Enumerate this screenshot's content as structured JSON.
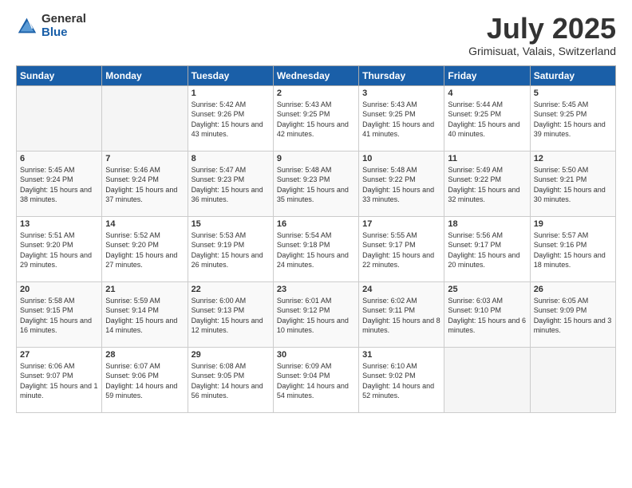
{
  "logo": {
    "general": "General",
    "blue": "Blue"
  },
  "header": {
    "month": "July 2025",
    "location": "Grimisuat, Valais, Switzerland"
  },
  "weekdays": [
    "Sunday",
    "Monday",
    "Tuesday",
    "Wednesday",
    "Thursday",
    "Friday",
    "Saturday"
  ],
  "weeks": [
    [
      {
        "day": "",
        "empty": true
      },
      {
        "day": "",
        "empty": true
      },
      {
        "day": "1",
        "sunrise": "5:42 AM",
        "sunset": "9:26 PM",
        "daylight": "15 hours and 43 minutes."
      },
      {
        "day": "2",
        "sunrise": "5:43 AM",
        "sunset": "9:25 PM",
        "daylight": "15 hours and 42 minutes."
      },
      {
        "day": "3",
        "sunrise": "5:43 AM",
        "sunset": "9:25 PM",
        "daylight": "15 hours and 41 minutes."
      },
      {
        "day": "4",
        "sunrise": "5:44 AM",
        "sunset": "9:25 PM",
        "daylight": "15 hours and 40 minutes."
      },
      {
        "day": "5",
        "sunrise": "5:45 AM",
        "sunset": "9:25 PM",
        "daylight": "15 hours and 39 minutes."
      }
    ],
    [
      {
        "day": "6",
        "sunrise": "5:45 AM",
        "sunset": "9:24 PM",
        "daylight": "15 hours and 38 minutes."
      },
      {
        "day": "7",
        "sunrise": "5:46 AM",
        "sunset": "9:24 PM",
        "daylight": "15 hours and 37 minutes."
      },
      {
        "day": "8",
        "sunrise": "5:47 AM",
        "sunset": "9:23 PM",
        "daylight": "15 hours and 36 minutes."
      },
      {
        "day": "9",
        "sunrise": "5:48 AM",
        "sunset": "9:23 PM",
        "daylight": "15 hours and 35 minutes."
      },
      {
        "day": "10",
        "sunrise": "5:48 AM",
        "sunset": "9:22 PM",
        "daylight": "15 hours and 33 minutes."
      },
      {
        "day": "11",
        "sunrise": "5:49 AM",
        "sunset": "9:22 PM",
        "daylight": "15 hours and 32 minutes."
      },
      {
        "day": "12",
        "sunrise": "5:50 AM",
        "sunset": "9:21 PM",
        "daylight": "15 hours and 30 minutes."
      }
    ],
    [
      {
        "day": "13",
        "sunrise": "5:51 AM",
        "sunset": "9:20 PM",
        "daylight": "15 hours and 29 minutes."
      },
      {
        "day": "14",
        "sunrise": "5:52 AM",
        "sunset": "9:20 PM",
        "daylight": "15 hours and 27 minutes."
      },
      {
        "day": "15",
        "sunrise": "5:53 AM",
        "sunset": "9:19 PM",
        "daylight": "15 hours and 26 minutes."
      },
      {
        "day": "16",
        "sunrise": "5:54 AM",
        "sunset": "9:18 PM",
        "daylight": "15 hours and 24 minutes."
      },
      {
        "day": "17",
        "sunrise": "5:55 AM",
        "sunset": "9:17 PM",
        "daylight": "15 hours and 22 minutes."
      },
      {
        "day": "18",
        "sunrise": "5:56 AM",
        "sunset": "9:17 PM",
        "daylight": "15 hours and 20 minutes."
      },
      {
        "day": "19",
        "sunrise": "5:57 AM",
        "sunset": "9:16 PM",
        "daylight": "15 hours and 18 minutes."
      }
    ],
    [
      {
        "day": "20",
        "sunrise": "5:58 AM",
        "sunset": "9:15 PM",
        "daylight": "15 hours and 16 minutes."
      },
      {
        "day": "21",
        "sunrise": "5:59 AM",
        "sunset": "9:14 PM",
        "daylight": "15 hours and 14 minutes."
      },
      {
        "day": "22",
        "sunrise": "6:00 AM",
        "sunset": "9:13 PM",
        "daylight": "15 hours and 12 minutes."
      },
      {
        "day": "23",
        "sunrise": "6:01 AM",
        "sunset": "9:12 PM",
        "daylight": "15 hours and 10 minutes."
      },
      {
        "day": "24",
        "sunrise": "6:02 AM",
        "sunset": "9:11 PM",
        "daylight": "15 hours and 8 minutes."
      },
      {
        "day": "25",
        "sunrise": "6:03 AM",
        "sunset": "9:10 PM",
        "daylight": "15 hours and 6 minutes."
      },
      {
        "day": "26",
        "sunrise": "6:05 AM",
        "sunset": "9:09 PM",
        "daylight": "15 hours and 3 minutes."
      }
    ],
    [
      {
        "day": "27",
        "sunrise": "6:06 AM",
        "sunset": "9:07 PM",
        "daylight": "15 hours and 1 minute."
      },
      {
        "day": "28",
        "sunrise": "6:07 AM",
        "sunset": "9:06 PM",
        "daylight": "14 hours and 59 minutes."
      },
      {
        "day": "29",
        "sunrise": "6:08 AM",
        "sunset": "9:05 PM",
        "daylight": "14 hours and 56 minutes."
      },
      {
        "day": "30",
        "sunrise": "6:09 AM",
        "sunset": "9:04 PM",
        "daylight": "14 hours and 54 minutes."
      },
      {
        "day": "31",
        "sunrise": "6:10 AM",
        "sunset": "9:02 PM",
        "daylight": "14 hours and 52 minutes."
      },
      {
        "day": "",
        "empty": true
      },
      {
        "day": "",
        "empty": true
      }
    ]
  ]
}
